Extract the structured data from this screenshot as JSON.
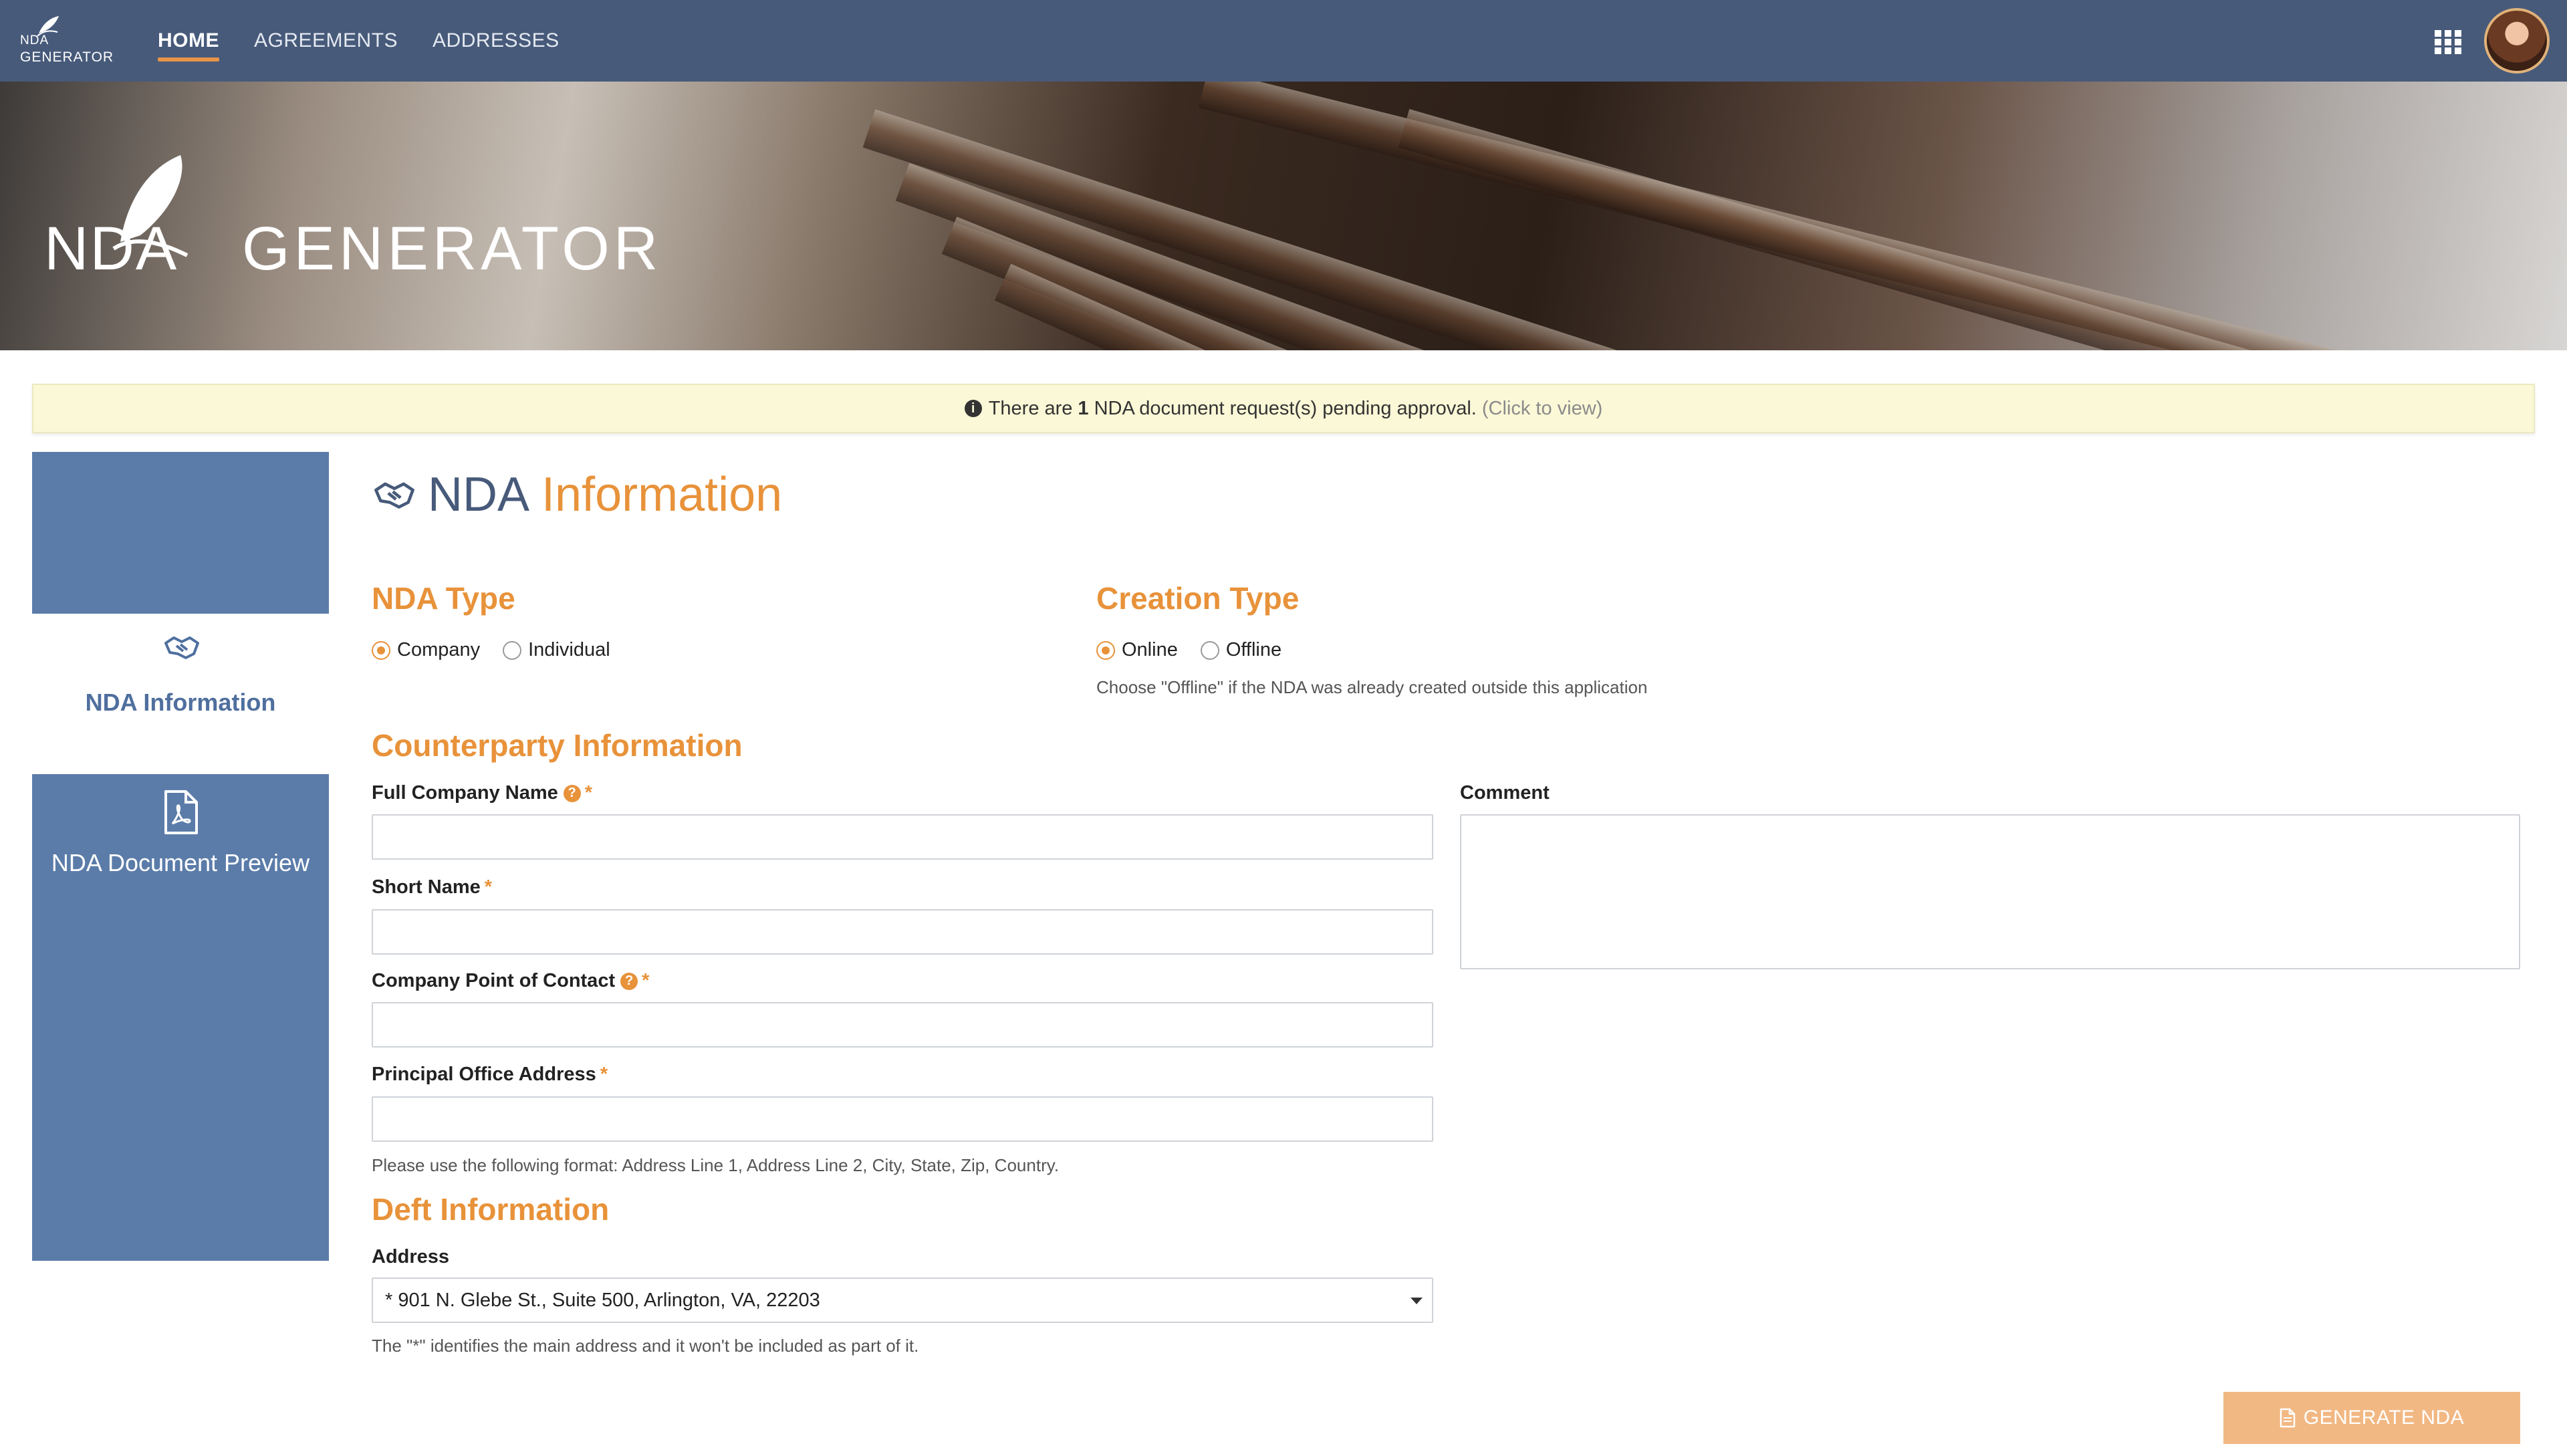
{
  "app": {
    "logo_line1": "NDA",
    "logo_line2": "GENERATOR"
  },
  "nav": {
    "items": [
      {
        "label": "HOME",
        "active": true
      },
      {
        "label": "AGREEMENTS",
        "active": false
      },
      {
        "label": "ADDRESSES",
        "active": false
      }
    ],
    "apps_icon": "grid-icon",
    "avatar_icon": "user-avatar"
  },
  "banner": {
    "nda": "NDA",
    "generator": "GENERATOR"
  },
  "alert": {
    "prefix": "There are",
    "count": "1",
    "suffix": "NDA document request(s) pending approval.",
    "click": "(Click to view)"
  },
  "sidebar": {
    "items": [
      {
        "label": "NDA Information",
        "icon": "handshake-icon",
        "active": true
      },
      {
        "label": "NDA Document Preview",
        "icon": "pdf-file-icon",
        "active": false
      }
    ]
  },
  "page": {
    "title_part1": "NDA",
    "title_part2": "Information",
    "title_icon": "handshake-icon"
  },
  "nda_type": {
    "title": "NDA Type",
    "options": [
      {
        "label": "Company",
        "checked": true
      },
      {
        "label": "Individual",
        "checked": false
      }
    ]
  },
  "creation_type": {
    "title": "Creation Type",
    "options": [
      {
        "label": "Online",
        "checked": true
      },
      {
        "label": "Offline",
        "checked": false
      }
    ],
    "hint": "Choose \"Offline\" if the NDA was already created outside this application"
  },
  "counterparty": {
    "title": "Counterparty Information",
    "full_company_name": {
      "label": "Full Company Name",
      "value": "",
      "required": "*"
    },
    "short_name": {
      "label": "Short Name",
      "value": "",
      "required": "*"
    },
    "point_of_contact": {
      "label": "Company Point of Contact",
      "value": "",
      "required": "*"
    },
    "principal_office": {
      "label": "Principal Office Address",
      "value": "",
      "required": "*"
    },
    "address_hint": "Please use the following format: Address Line 1, Address Line 2, City, State, Zip, Country.",
    "comment": {
      "label": "Comment",
      "value": ""
    }
  },
  "deft": {
    "title": "Deft Information",
    "address_label": "Address",
    "address_selected": "* 901 N. Glebe St., Suite 500, Arlington, VA, 22203",
    "address_hint": "The \"*\" identifies the main address and it won't be included as part of it."
  },
  "actions": {
    "generate_label": "GENERATE NDA"
  },
  "colors": {
    "navbar": "#475a7a",
    "accent": "#e8923a",
    "sidebar": "#5b7ca9",
    "alert_bg": "#fbf8d7"
  }
}
